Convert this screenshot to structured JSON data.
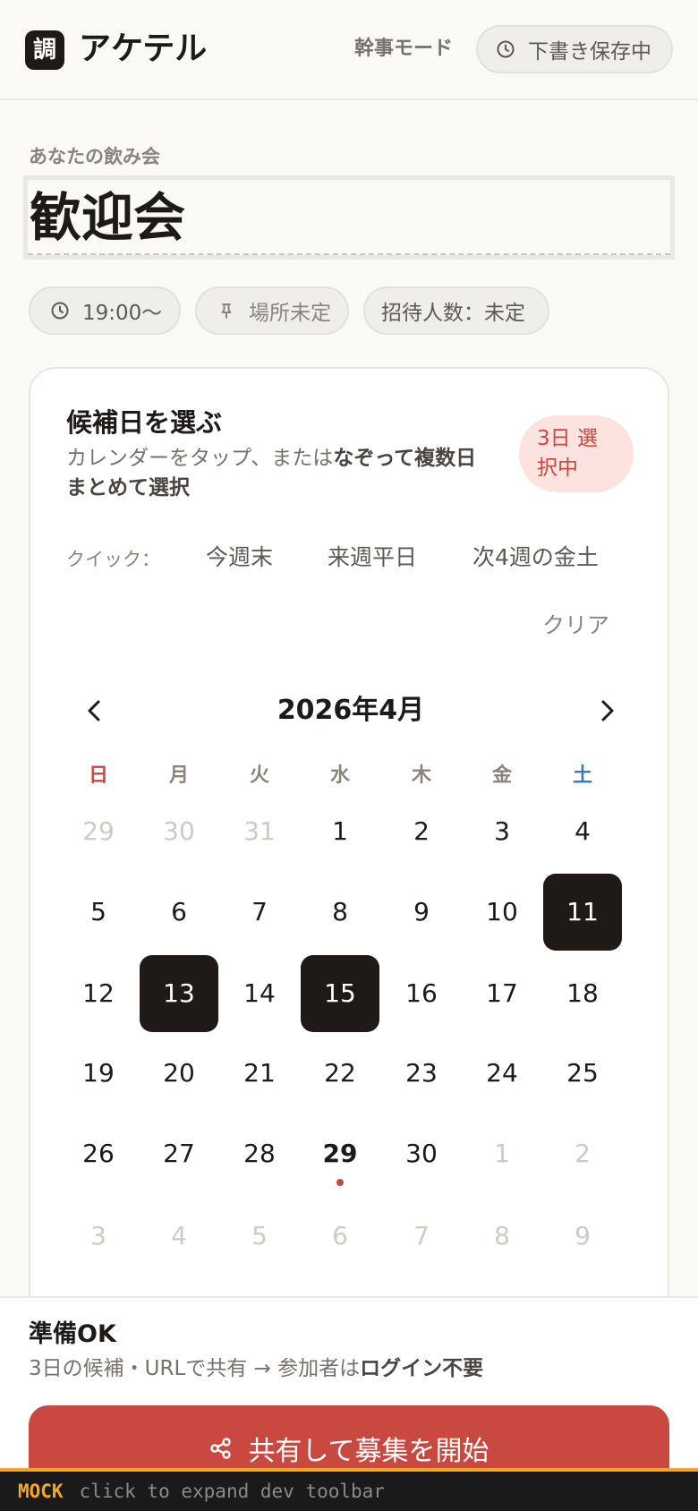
{
  "header": {
    "logo_char": "調",
    "app_name": "アケテル",
    "mode": "幹事モード",
    "draft_status": "下書き保存中"
  },
  "event": {
    "label": "あなたの飲み会",
    "title": "歓迎会"
  },
  "chips": {
    "time": "19:00〜",
    "place": "場所未定",
    "guests": "招待人数：未定"
  },
  "picker": {
    "title": "候補日を選ぶ",
    "desc_plain": "カレンダーをタップ、または",
    "desc_bold": "なぞって複数日まとめて選択",
    "badge_line1": "3日 選",
    "badge_line2": "択中",
    "quick_label": "クイック：",
    "quick": [
      "今週末",
      "来週平日",
      "次4週の金土"
    ],
    "clear": "クリア"
  },
  "calendar": {
    "month_title": "2026年4月",
    "weekdays": [
      "日",
      "月",
      "火",
      "水",
      "木",
      "金",
      "土"
    ],
    "weekday_colors": [
      "#c9483f",
      "#8a847d",
      "#8a847d",
      "#8a847d",
      "#8a847d",
      "#8a847d",
      "#3a78b5"
    ],
    "weeks": [
      [
        "29",
        "30",
        "31",
        "1",
        "2",
        "3",
        "4"
      ],
      [
        "5",
        "6",
        "7",
        "8",
        "9",
        "10",
        "11"
      ],
      [
        "12",
        "13",
        "14",
        "15",
        "16",
        "17",
        "18"
      ],
      [
        "19",
        "20",
        "21",
        "22",
        "23",
        "24",
        "25"
      ],
      [
        "26",
        "27",
        "28",
        "29",
        "30",
        "1",
        "2"
      ],
      [
        "3",
        "4",
        "5",
        "6",
        "7",
        "8",
        "9"
      ]
    ],
    "selected_days": [
      "11",
      "13",
      "15"
    ],
    "today": "29"
  },
  "footer": {
    "ready_title": "準備OK",
    "desc_plain": "3日の候補・URLで共有 → 参加者は",
    "desc_bold": "ログイン不要",
    "share_button": "共有して募集を開始"
  },
  "mock_bar": {
    "tag": "MOCK",
    "hint": "click to expand dev toolbar"
  },
  "colors": {
    "accent": "#c9483f",
    "dark": "#1e1a17",
    "badge_bg": "#fde3df",
    "mock": "#f5a623"
  }
}
